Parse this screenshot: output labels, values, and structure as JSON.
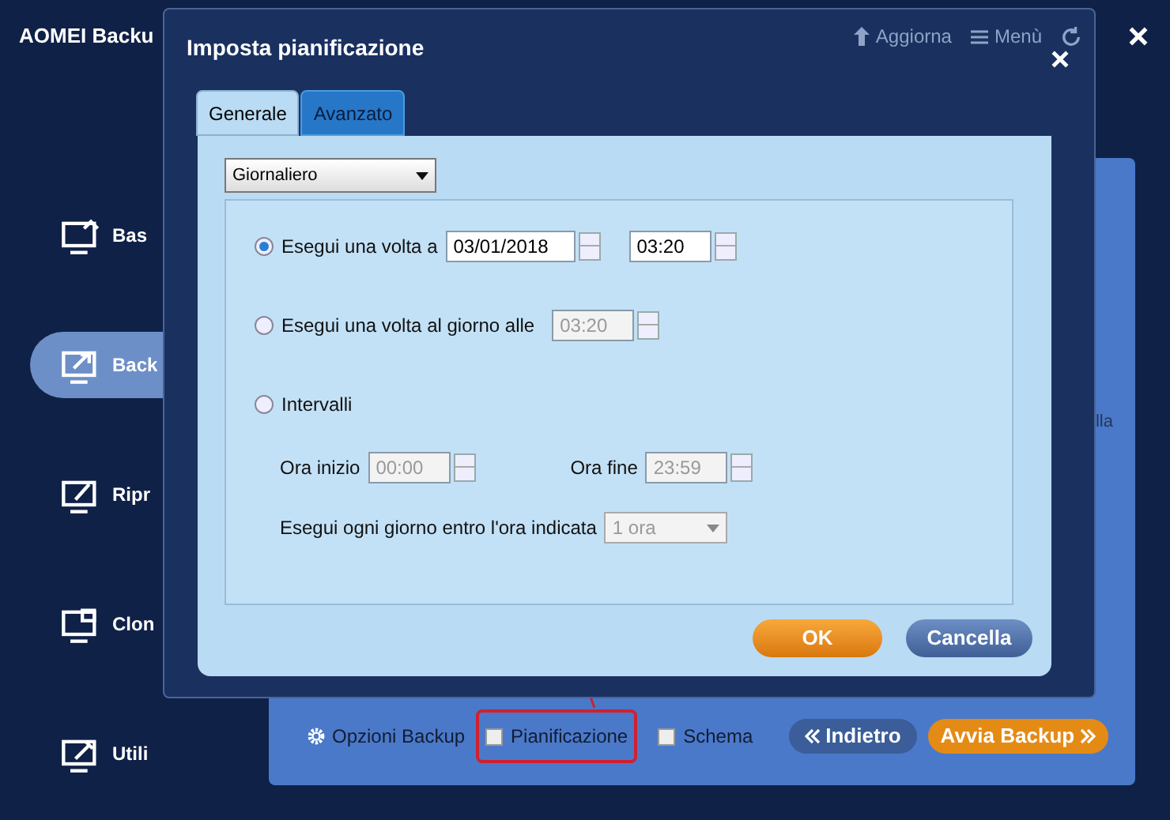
{
  "app": {
    "title": "AOMEI Backu",
    "toolbar": [
      {
        "kind": "update",
        "label": "Aggiorna"
      },
      {
        "kind": "menu",
        "label": "Menù"
      }
    ]
  },
  "sidebar": {
    "items": [
      {
        "kind": "home",
        "label": "Bas",
        "selected": false
      },
      {
        "kind": "backup",
        "label": "Back",
        "selected": true
      },
      {
        "kind": "restore",
        "label": "Ripr",
        "selected": false
      },
      {
        "kind": "clone",
        "label": "Clon",
        "selected": false
      },
      {
        "kind": "tools",
        "label": "Utili",
        "selected": false
      }
    ]
  },
  "panel": {
    "fragment": "lla",
    "options_label": "Opzioni Backup",
    "checks": [
      {
        "label": "Pianificazione",
        "checked": false,
        "highlighted": true
      },
      {
        "label": "Schema",
        "checked": false,
        "highlighted": false
      }
    ],
    "back_button": "Indietro",
    "start_button": "Avvia Backup"
  },
  "dialog": {
    "title": "Imposta pianificazione",
    "tabs": [
      {
        "label": "Generale",
        "selected": true
      },
      {
        "label": "Avanzato",
        "selected": false
      }
    ],
    "frequency": "Giornaliero",
    "options": [
      {
        "label": "Esegui una volta a",
        "selected": true,
        "date": "03/01/2018",
        "time": "03:20"
      },
      {
        "label": "Esegui una volta al giorno alle",
        "selected": false,
        "time": "03:20"
      },
      {
        "label": "Intervalli",
        "selected": false
      }
    ],
    "start_label": "Ora inizio",
    "start_time": "00:00",
    "end_label": "Ora fine",
    "end_time": "23:59",
    "within_label": "Esegui ogni giorno entro l'ora indicata",
    "within_value": "1 ora",
    "ok": "OK",
    "cancel": "Cancella"
  }
}
